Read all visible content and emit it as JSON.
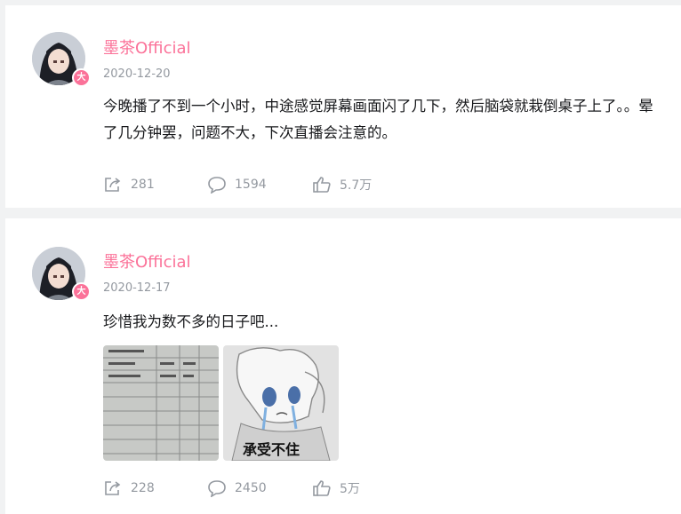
{
  "posts": [
    {
      "username": "墨茶Official",
      "badge": "大",
      "date": "2020-12-20",
      "text": "今晚播了不到一个小时，中途感觉屏幕画面闪了几下，然后脑袋就栽倒桌子上了。。晕了几分钟罢，问题不大，下次直播会注意的。",
      "shares": "281",
      "comments": "1594",
      "likes": "5.7万"
    },
    {
      "username": "墨茶Official",
      "badge": "大",
      "date": "2020-12-17",
      "text": "珍惜我为数不多的日子吧...",
      "sticker_caption": "承受不住",
      "shares": "228",
      "comments": "2450",
      "likes": "5万"
    }
  ],
  "icons": {
    "share": "share-icon",
    "comment": "comment-icon",
    "like": "thumbs-up-icon"
  },
  "colors": {
    "accent": "#fb7299",
    "meta": "#9499a0",
    "text": "#18191c",
    "page_bg": "#f1f2f3"
  }
}
